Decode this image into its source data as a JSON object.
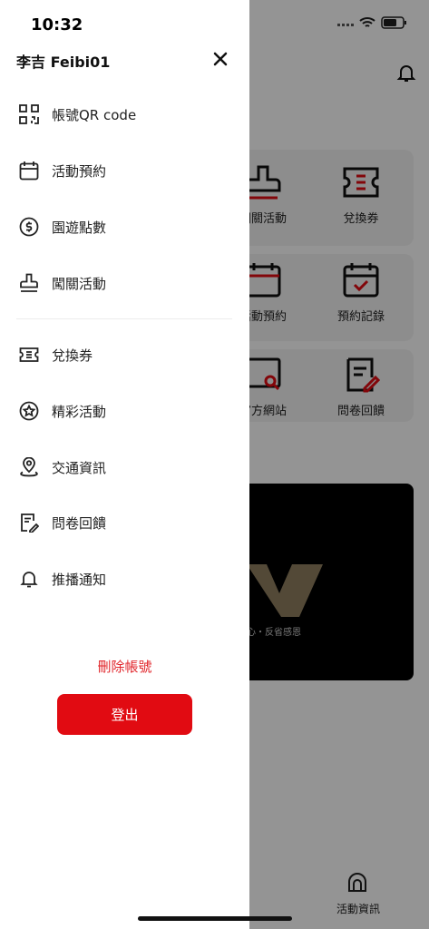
{
  "status": {
    "time": "10:32"
  },
  "drawer": {
    "user_name": "李吉 Feibi01",
    "menu": [
      {
        "label": "帳號QR code",
        "icon": "qr-code-icon"
      },
      {
        "label": "活動預約",
        "icon": "calendar-icon"
      },
      {
        "label": "園遊點數",
        "icon": "dollar-coin-icon"
      },
      {
        "label": "闖關活動",
        "icon": "stamp-icon"
      },
      {
        "label": "兌換券",
        "icon": "ticket-icon"
      },
      {
        "label": "精彩活動",
        "icon": "star-circle-icon"
      },
      {
        "label": "交通資訊",
        "icon": "location-pin-icon"
      },
      {
        "label": "問卷回饋",
        "icon": "survey-edit-icon"
      },
      {
        "label": "推播通知",
        "icon": "bell-icon"
      }
    ],
    "delete_account": "刪除帳號",
    "logout": "登出"
  },
  "background": {
    "tiles": [
      {
        "label": "闖關活動"
      },
      {
        "label": "兌換券"
      },
      {
        "label": "活動預約"
      },
      {
        "label": "預約記錄"
      },
      {
        "label": "官方網站"
      },
      {
        "label": "問卷回饋"
      }
    ],
    "banner_tagline": "心・反省感恩",
    "tab_label": "活動資訊"
  },
  "colors": {
    "accent": "#e10b12",
    "delete_text": "#e1262b"
  }
}
